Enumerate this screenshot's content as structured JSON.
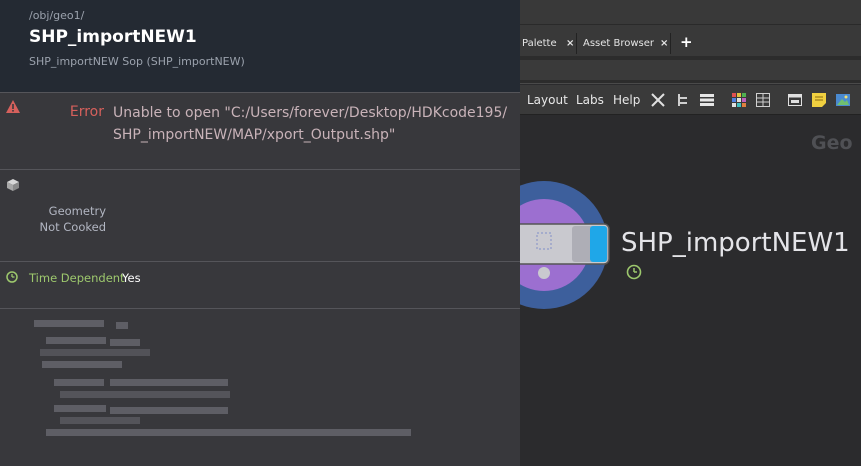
{
  "info": {
    "path": "/obj/geo1/",
    "title": "SHP_importNEW1",
    "subtitle": "SHP_importNEW Sop (SHP_importNEW)",
    "error": {
      "label": "Error",
      "message_line1": "Unable to open \"C:/Users/forever/Desktop/HDKcode195/",
      "message_line2": "SHP_importNEW/MAP/xport_Output.shp\""
    },
    "geometry": {
      "line1": "Geometry",
      "line2": "Not Cooked"
    },
    "time_dependent": {
      "label": "Time Dependent",
      "value": "Yes"
    }
  },
  "network": {
    "tabs": [
      {
        "label": "Palette",
        "close": "×"
      },
      {
        "label": "Asset Browser",
        "close": "×"
      }
    ],
    "add_tab": "+",
    "menu": [
      "Layout",
      "Labs",
      "Help"
    ],
    "context_label": "Geo",
    "node_name": "SHP_importNEW1"
  },
  "colors": {
    "error_red": "#d6605c",
    "time_dep_green": "#9dc86d",
    "node_ring_outer": "#3d5f9c",
    "node_ring_inner": "#9c6fd0",
    "node_flag_blue": "#1fa7e8"
  },
  "icons": [
    "warning-icon",
    "geometry-cube-icon",
    "clock-icon",
    "wrench-icon",
    "tree-icon",
    "list-icon",
    "grid-icon",
    "table-icon",
    "window-icon",
    "sticky-note-icon",
    "image-icon"
  ]
}
